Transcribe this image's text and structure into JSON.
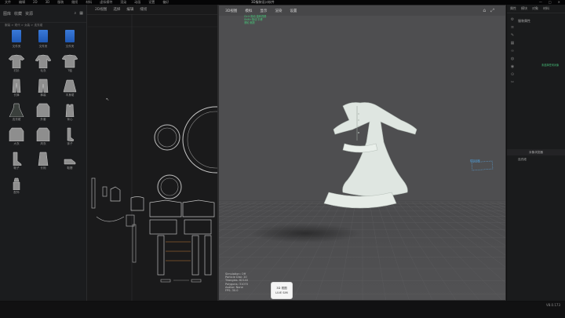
{
  "menubar": {
    "items": [
      "文件",
      "编辑",
      "2D",
      "3D",
      "服装",
      "缝纫",
      "材料",
      "虚拟模特",
      "渲染",
      "动画",
      "设置",
      "偏好"
    ],
    "app_title": "3D服装设计软件",
    "controls": [
      "—",
      "□",
      "✕"
    ]
  },
  "library": {
    "header_tabs": [
      "图库",
      "收藏",
      "资源"
    ],
    "breadcrumb": "服装 > 现代 > 女装 > 连衣裙",
    "items": [
      {
        "label": "文件夹",
        "kind": "folder"
      },
      {
        "label": "文件夹",
        "kind": "folder"
      },
      {
        "label": "文件夹",
        "kind": "folder"
      },
      {
        "label": "衬衫",
        "kind": "shirt"
      },
      {
        "label": "毛衣",
        "kind": "sweater"
      },
      {
        "label": "T恤",
        "kind": "tee"
      },
      {
        "label": "长裤",
        "kind": "pants"
      },
      {
        "label": "裤装",
        "kind": "pants2"
      },
      {
        "label": "半身裙",
        "kind": "skirt"
      },
      {
        "label": "连衣裙",
        "kind": "dress"
      },
      {
        "label": "外套",
        "kind": "coat"
      },
      {
        "label": "背心",
        "kind": "vest"
      },
      {
        "label": "大衣",
        "kind": "coat2"
      },
      {
        "label": "风衣",
        "kind": "coat3"
      },
      {
        "label": "袜子",
        "kind": "socks"
      },
      {
        "label": "靴子",
        "kind": "boots"
      },
      {
        "label": "长袍",
        "kind": "robe"
      },
      {
        "label": "鞋履",
        "kind": "shoes"
      },
      {
        "label": "配饰",
        "kind": "acc"
      }
    ]
  },
  "pattern": {
    "toolbar": [
      "2D视图",
      "选择",
      "编辑",
      "缝纫"
    ]
  },
  "viewport": {
    "toolbar": [
      "3D视图",
      "模拟",
      "显示",
      "渲染",
      "设置"
    ],
    "info_lines": [
      "Simulation: Off",
      "Particle Dist: 20",
      "Triangles: 62140",
      "Polygons: 31070",
      "Avatar: None",
      "FPS: 30.0"
    ],
    "button_label": "3D 视图",
    "button_sub": "LIVE SIM",
    "tooltip_lines": [
      "Ctrl+拖动 旋转视角",
      "Shift+拖动 平移",
      "滚轮 缩放"
    ],
    "tooltip2": "模拟网格"
  },
  "right": {
    "tabs": [
      "属性",
      "模块",
      "对象",
      "材料"
    ],
    "prop_title": "服装属性",
    "prop_note": "未选择任何对象",
    "lower_title": "对象浏览器",
    "object_name": "连衣裙"
  },
  "status": {
    "version": "V8.0.173"
  },
  "colors": {
    "viewport_bg": "#4e4e50",
    "garment": "#dfe6e1",
    "folder": "#2e6bcf",
    "accent_green": "#46d67e"
  }
}
